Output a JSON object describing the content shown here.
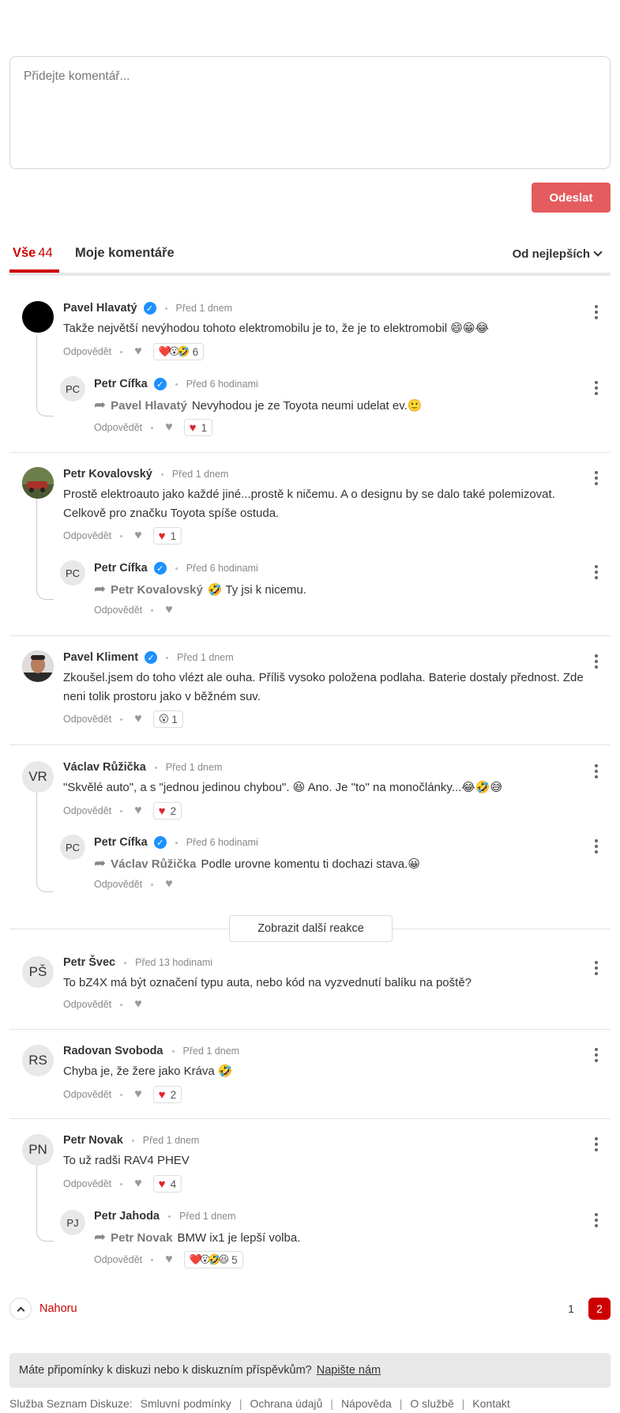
{
  "compose": {
    "placeholder": "Přidejte komentář...",
    "send_label": "Odeslat"
  },
  "tabs": {
    "all_label": "Vše",
    "all_count": "44",
    "mine_label": "Moje komentáře",
    "sort_label": "Od nejlepších"
  },
  "labels": {
    "reply": "Odpovědět",
    "show_more": "Zobrazit další reakce",
    "to_top": "Nahoru"
  },
  "comments": [
    {
      "initials": "",
      "name": "Pavel Hlavatý",
      "time": "Před 1 dnem",
      "text": "Takže největší nevýhodou tohoto elektromobilu je to, že je to elektromobil 😄😁😂",
      "reactions": "❤️😮🤣",
      "reaction_count": "6"
    },
    {
      "initials": "PC",
      "name": "Petr Cífka",
      "time": "Před 6 hodinami",
      "reply_to": "Pavel Hlavatý",
      "text": "Nevyhodou je ze Toyota neumi udelat ev.🙂",
      "reactions": "❤️",
      "reaction_count": "1"
    },
    {
      "initials": "",
      "name": "Petr Kovalovský",
      "time": "Před 1 dnem",
      "text": "Prostě elektroauto jako každé jiné...prostě k ničemu. A o designu by se dalo také polemizovat. Celkově pro značku Toyota spíše ostuda.",
      "reactions": "❤️",
      "reaction_count": "1"
    },
    {
      "initials": "PC",
      "name": "Petr Cífka",
      "time": "Před 6 hodinami",
      "reply_to": "Petr Kovalovský",
      "text": "🤣 Ty jsi k nicemu."
    },
    {
      "initials": "",
      "name": "Pavel Kliment",
      "time": "Před 1 dnem",
      "text": "Zkoušel.jsem do toho vlézt ale ouha. Příliš vysoko položena podlaha. Baterie dostaly přednost. Zde neni tolik prostoru jako v běžném suv.",
      "reactions": "😮",
      "reaction_count": "1"
    },
    {
      "initials": "VR",
      "name": "Václav Růžička",
      "time": "Před 1 dnem",
      "text": "\"Skvělé auto\", a s \"jednou jedinou chybou\". 😆 Ano. Je \"to\" na monočlánky...😂🤣😅",
      "reactions": "❤️",
      "reaction_count": "2"
    },
    {
      "initials": "PC",
      "name": "Petr Cífka",
      "time": "Před 6 hodinami",
      "reply_to": "Václav Růžička",
      "text": "Podle urovne komentu ti dochazi stava.😀"
    },
    {
      "initials": "PŠ",
      "name": "Petr Švec",
      "time": "Před 13 hodinami",
      "text": "To bZ4X má být označení typu auta, nebo kód na vyzvednutí balíku na poště?"
    },
    {
      "initials": "RS",
      "name": "Radovan Svoboda",
      "time": "Před 1 dnem",
      "text": "Chyba je, že žere jako Kráva 🤣",
      "reactions": "❤️",
      "reaction_count": "2"
    },
    {
      "initials": "PN",
      "name": "Petr Novak",
      "time": "Před 1 dnem",
      "text": "To už radši RAV4 PHEV",
      "reactions": "❤️",
      "reaction_count": "4"
    },
    {
      "initials": "PJ",
      "name": "Petr Jahoda",
      "time": "Před 1 dnem",
      "reply_to": "Petr Novak",
      "text": "BMW ix1 je lepší volba.",
      "reactions": "❤️😮🤣😆",
      "reaction_count": "5"
    }
  ],
  "pagination": {
    "pages": [
      "1",
      "2"
    ],
    "current": "2"
  },
  "feedback": {
    "text": "Máte připomínky k diskuzi nebo k diskuzním příspěvkům?",
    "link": "Napište nám"
  },
  "footer": {
    "prefix": "Služba Seznam Diskuze:",
    "links": [
      "Smluvní podmínky",
      "Ochrana údajů",
      "Nápověda",
      "O službě",
      "Kontakt"
    ]
  },
  "colors": {
    "accent": "#cc0000",
    "send_button": "#e45c5f",
    "verified": "#1e90ff",
    "heart": "#e0242e"
  }
}
